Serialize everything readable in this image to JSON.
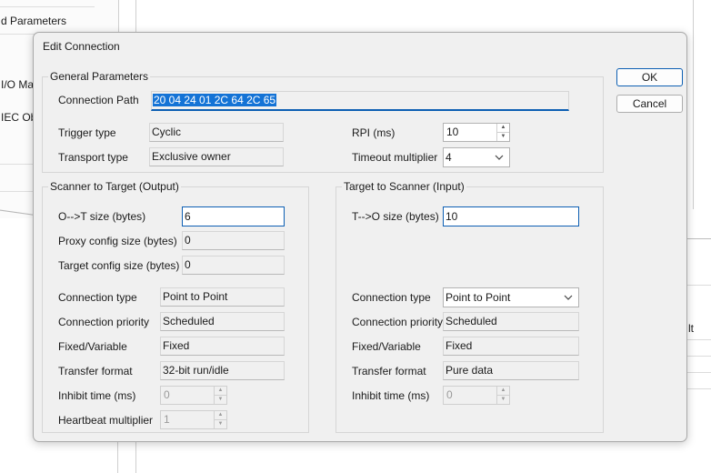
{
  "background": {
    "left_items": [
      "d Parameters",
      "I/O Ma",
      "IEC Ob"
    ],
    "grid_header_text": "lt"
  },
  "dialog": {
    "title": "Edit Connection",
    "ok_label": "OK",
    "cancel_label": "Cancel",
    "general": {
      "title": "General Parameters",
      "connection_path_label": "Connection Path",
      "connection_path_value": "20 04 24 01 2C 64 2C 65",
      "trigger_type_label": "Trigger type",
      "trigger_type_value": "Cyclic",
      "transport_type_label": "Transport type",
      "transport_type_value": "Exclusive owner",
      "rpi_label": "RPI (ms)",
      "rpi_value": "10",
      "timeout_multiplier_label": "Timeout multiplier",
      "timeout_multiplier_value": "4"
    },
    "scanner_to_target": {
      "title": "Scanner to Target (Output)",
      "o_t_size_label": "O-->T size (bytes)",
      "o_t_size_value": "6",
      "proxy_config_label": "Proxy config size (bytes)",
      "proxy_config_value": "0",
      "target_config_label": "Target config size (bytes)",
      "target_config_value": "0",
      "connection_type_label": "Connection type",
      "connection_type_value": "Point to Point",
      "connection_priority_label": "Connection priority",
      "connection_priority_value": "Scheduled",
      "fixed_variable_label": "Fixed/Variable",
      "fixed_variable_value": "Fixed",
      "transfer_format_label": "Transfer format",
      "transfer_format_value": "32-bit run/idle",
      "inhibit_time_label": "Inhibit time (ms)",
      "inhibit_time_value": "0",
      "heartbeat_label": "Heartbeat multiplier",
      "heartbeat_value": "1"
    },
    "target_to_scanner": {
      "title": "Target to Scanner (Input)",
      "t_o_size_label": "T-->O size (bytes)",
      "t_o_size_value": "10",
      "connection_type_label": "Connection type",
      "connection_type_value": "Point to Point",
      "connection_priority_label": "Connection priority",
      "connection_priority_value": "Scheduled",
      "fixed_variable_label": "Fixed/Variable",
      "fixed_variable_value": "Fixed",
      "transfer_format_label": "Transfer format",
      "transfer_format_value": "Pure data",
      "inhibit_time_label": "Inhibit time (ms)",
      "inhibit_time_value": "0"
    }
  },
  "colors": {
    "accent": "#0d5fb3",
    "selection": "#1473d6",
    "dialog_bg": "#f0f0f0"
  }
}
